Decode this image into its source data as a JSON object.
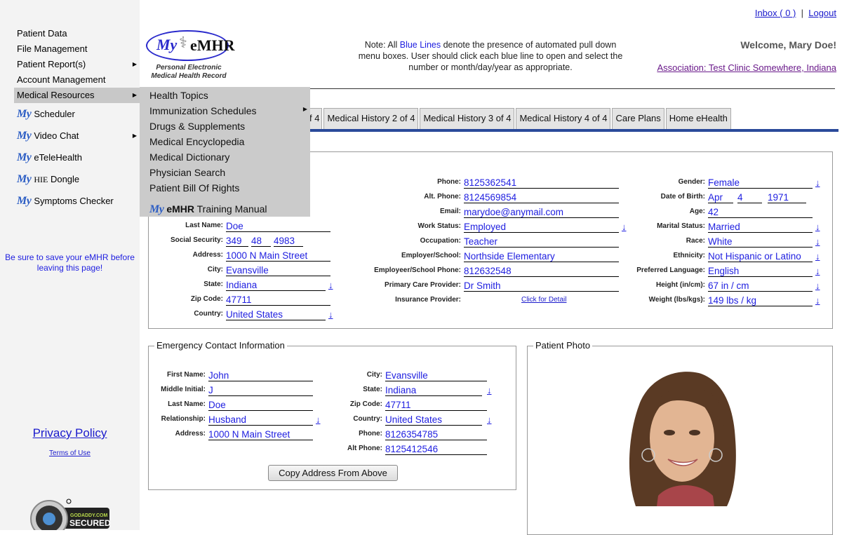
{
  "sidebar": {
    "items": [
      {
        "label": "Patient Data",
        "has_submenu": false
      },
      {
        "label": "File Management",
        "has_submenu": false
      },
      {
        "label": "Patient Report(s)",
        "has_submenu": true
      },
      {
        "label": "Account Management",
        "has_submenu": false
      },
      {
        "label": "Medical Resources",
        "has_submenu": true,
        "active": true
      }
    ],
    "my_items": [
      {
        "prefix": "My",
        "label": "Scheduler",
        "has_submenu": false
      },
      {
        "prefix": "My",
        "label": "Video Chat",
        "has_submenu": true
      },
      {
        "prefix": "My",
        "label": "eTeleHealth",
        "has_submenu": false
      },
      {
        "prefix": "My",
        "label_pre": "HIE",
        "label": "Dongle",
        "has_submenu": false
      },
      {
        "prefix": "My",
        "label": "Symptoms Checker",
        "has_submenu": false
      }
    ],
    "save_note": "Be sure to save your eMHR before leaving this page!",
    "privacy_policy": "Privacy Policy",
    "terms_of_use": "Terms of Use",
    "seal": {
      "brand": "GODADDY.COM",
      "label": "SECURED"
    }
  },
  "submenu": {
    "items": [
      {
        "label": "Health Topics"
      },
      {
        "label": "Immunization Schedules",
        "has_submenu": true
      },
      {
        "label": "Drugs & Supplements"
      },
      {
        "label": "Medical Encyclopedia"
      },
      {
        "label": "Medical Dictionary"
      },
      {
        "label": "Physician Search"
      },
      {
        "label": "Patient Bill Of Rights"
      }
    ],
    "manual": {
      "prefix": "My",
      "bold": "eMHR",
      "label": "Training Manual"
    }
  },
  "header": {
    "logo": {
      "my": "My",
      "emhr": "eMHR",
      "line1": "Personal Electronic",
      "line2": "Medical Health Record"
    },
    "note_pre": "Note: All ",
    "note_blue": "Blue Lines",
    "note_post": " denote the presence of automated pull down menu boxes. User should click each blue line to open and select the number or month/day/year as appropriate.",
    "inbox": "Inbox ( 0 )",
    "separator": "|",
    "logout": "Logout",
    "welcome": "Welcome, Mary Doe!",
    "association": "Association: Test Clinic Somewhere, Indiana"
  },
  "tabs": [
    {
      "label": "f 4"
    },
    {
      "label": "Medical History 2 of 4"
    },
    {
      "label": "Medical History 3 of 4"
    },
    {
      "label": "Medical History 4 of 4"
    },
    {
      "label": "Care Plans"
    },
    {
      "label": "Home eHealth"
    }
  ],
  "demographics": {
    "col1": [
      {
        "label": "Last Name:",
        "value": "Doe"
      },
      {
        "label": "Social Security:",
        "parts": [
          "349",
          "48",
          "4983"
        ]
      },
      {
        "label": "Address:",
        "value": "1000 N Main Street"
      },
      {
        "label": "City:",
        "value": "Evansville"
      },
      {
        "label": "State:",
        "value": "Indiana",
        "dropdown": true
      },
      {
        "label": "Zip Code:",
        "value": "47711"
      },
      {
        "label": "Country:",
        "value": "United States",
        "dropdown": true
      }
    ],
    "col2": [
      {
        "label": "Phone:",
        "value": "8125362541"
      },
      {
        "label": "Alt. Phone:",
        "value": "8124569854"
      },
      {
        "label": "Email:",
        "value": "marydoe@anymail.com"
      },
      {
        "label": "Work Status:",
        "value": "Employed",
        "dropdown": true
      },
      {
        "label": "Occupation:",
        "value": "Teacher"
      },
      {
        "label": "Employer/School:",
        "value": "Northside Elementary"
      },
      {
        "label": "Employeer/School Phone:",
        "value": "812632548"
      },
      {
        "label": "Primary Care Provider:",
        "value": "Dr Smith"
      },
      {
        "label": "Insurance Provider:",
        "link": "Click for Detail"
      }
    ],
    "col3": [
      {
        "label": "Gender:",
        "value": "Female",
        "dropdown": true
      },
      {
        "label": "Date of Birth:",
        "parts": [
          "Apr",
          "4",
          "1971"
        ]
      },
      {
        "label": "Age:",
        "value": "42"
      },
      {
        "label": "Marital Status:",
        "value": "Married",
        "dropdown": true
      },
      {
        "label": "Race:",
        "value": "White",
        "dropdown": true
      },
      {
        "label": "Ethnicity:",
        "value": "Not Hispanic or Latino",
        "dropdown": true
      },
      {
        "label": "Preferred Language:",
        "value": "English",
        "dropdown": true
      },
      {
        "label": "Height (in/cm):",
        "value": "67 in / cm",
        "dropdown": true
      },
      {
        "label": "Weight (lbs/kgs):",
        "value": "149 lbs / kg",
        "dropdown": true
      }
    ]
  },
  "emergency": {
    "legend": "Emergency Contact Information",
    "col1": [
      {
        "label": "First Name:",
        "value": "John"
      },
      {
        "label": "Middle Initial:",
        "value": "J"
      },
      {
        "label": "Last Name:",
        "value": "Doe"
      },
      {
        "label": "Relationship:",
        "value": "Husband",
        "dropdown": true
      },
      {
        "label": "Address:",
        "value": "1000 N Main Street"
      }
    ],
    "col2": [
      {
        "label": "City:",
        "value": "Evansville"
      },
      {
        "label": "State:",
        "value": "Indiana",
        "dropdown": true
      },
      {
        "label": "Zip Code:",
        "value": "47711"
      },
      {
        "label": "Country:",
        "value": "United States",
        "dropdown": true
      },
      {
        "label": "Phone:",
        "value": "8126354785"
      },
      {
        "label": "Alt Phone:",
        "value": "8125412546"
      }
    ],
    "copy_button": "Copy Address From Above"
  },
  "photo": {
    "legend": "Patient Photo"
  },
  "icons": {
    "dropdown": "↓",
    "submenu_arrow": "▶"
  },
  "colors": {
    "value_blue": "#2020e0",
    "tab_bar": "#2a4a9a",
    "sidebar_bg": "#f3f3f3",
    "menu_bg": "#cbcbcb"
  }
}
